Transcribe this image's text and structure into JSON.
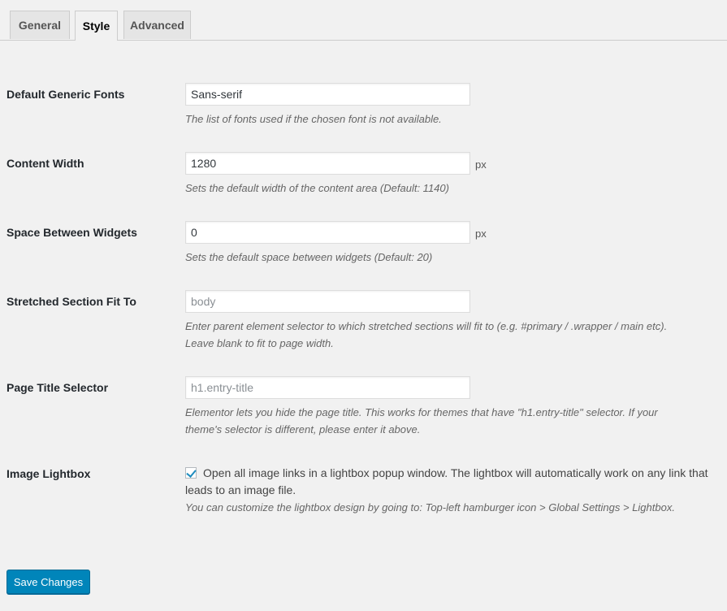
{
  "tabs": [
    {
      "label": "General",
      "active": false
    },
    {
      "label": "Style",
      "active": true
    },
    {
      "label": "Advanced",
      "active": false
    }
  ],
  "settings": {
    "generic_fonts": {
      "label": "Default Generic Fonts",
      "value": "Sans-serif",
      "description": "The list of fonts used if the chosen font is not available."
    },
    "content_width": {
      "label": "Content Width",
      "value": "1280",
      "unit": "px",
      "description": "Sets the default width of the content area (Default: 1140)"
    },
    "space_between_widgets": {
      "label": "Space Between Widgets",
      "value": "0",
      "unit": "px",
      "description": "Sets the default space between widgets (Default: 20)"
    },
    "stretched_section": {
      "label": "Stretched Section Fit To",
      "placeholder": "body",
      "description_line1": "Enter parent element selector to which stretched sections will fit to (e.g. #primary / .wrapper / main etc).",
      "description_line2": "Leave blank to fit to page width."
    },
    "page_title_selector": {
      "label": "Page Title Selector",
      "placeholder": "h1.entry-title",
      "description_line1": "Elementor lets you hide the page title. This works for themes that have \"h1.entry-title\" selector. If your",
      "description_line2": "theme's selector is different, please enter it above."
    },
    "image_lightbox": {
      "label": "Image Lightbox",
      "checked": true,
      "checkbox_text": "Open all image links in a lightbox popup window. The lightbox will automatically work on any link that leads to an image file.",
      "description": "You can customize the lightbox design by going to: Top-left hamburger icon > Global Settings > Lightbox."
    }
  },
  "save_button": "Save Changes",
  "colors": {
    "primary": "#0085ba",
    "background": "#f1f1f1"
  }
}
